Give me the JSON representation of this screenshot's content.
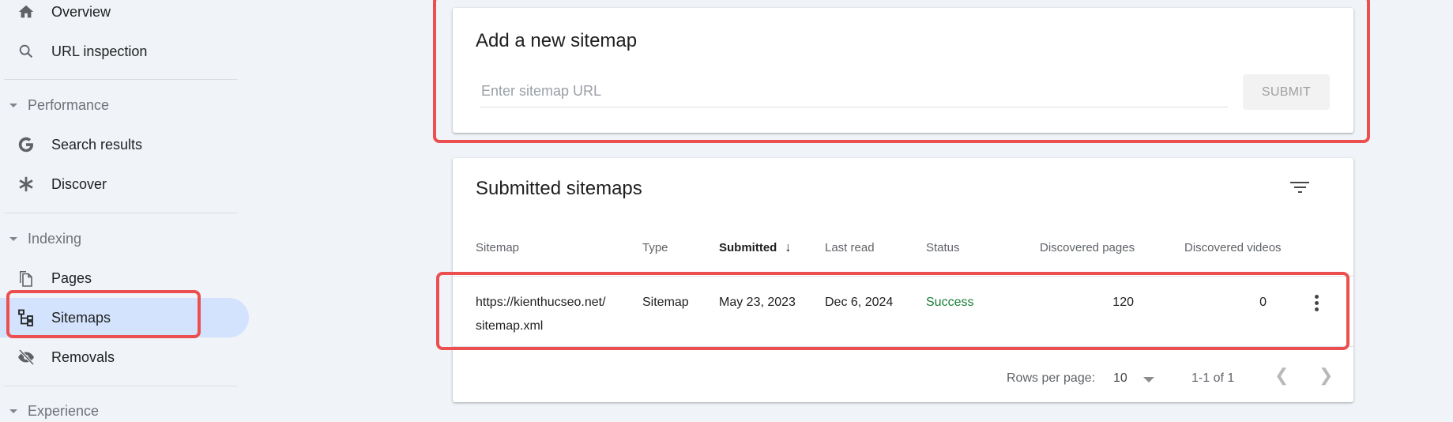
{
  "sidebar": {
    "items": [
      {
        "label": "Overview",
        "icon": "home-icon"
      },
      {
        "label": "URL inspection",
        "icon": "search-icon"
      }
    ],
    "sections": [
      {
        "label": "Performance",
        "items": [
          {
            "label": "Search results",
            "icon": "google-g-icon"
          },
          {
            "label": "Discover",
            "icon": "asterisk-icon"
          }
        ]
      },
      {
        "label": "Indexing",
        "items": [
          {
            "label": "Pages",
            "icon": "pages-icon"
          },
          {
            "label": "Sitemaps",
            "icon": "sitemap-icon",
            "active": true
          },
          {
            "label": "Removals",
            "icon": "eye-off-icon"
          }
        ]
      },
      {
        "label": "Experience",
        "items": []
      }
    ]
  },
  "add_sitemap": {
    "title": "Add a new sitemap",
    "input_placeholder": "Enter sitemap URL",
    "input_value": "",
    "submit_label": "SUBMIT"
  },
  "submitted": {
    "title": "Submitted sitemaps",
    "filter_icon": "filter-icon",
    "columns": [
      "Sitemap",
      "Type",
      "Submitted",
      "Last read",
      "Status",
      "Discovered pages",
      "Discovered videos"
    ],
    "sorted_column": "Submitted",
    "sort_direction": "descending",
    "rows": [
      {
        "sitemap_line1": "https://kienthucseo.net/",
        "sitemap_line2": "sitemap.xml",
        "type": "Sitemap",
        "submitted": "May 23, 2023",
        "last_read": "Dec 6, 2024",
        "status": "Success",
        "discovered_pages": "120",
        "discovered_videos": "0"
      }
    ],
    "pagination": {
      "rows_per_page_label": "Rows per page:",
      "rows_per_page_value": "10",
      "range": "1-1 of 1"
    }
  },
  "colors": {
    "accent_highlight": "#d3e3fd",
    "annotation_red": "#ec4f4f",
    "success": "#188038",
    "background": "#f0f4f9"
  }
}
